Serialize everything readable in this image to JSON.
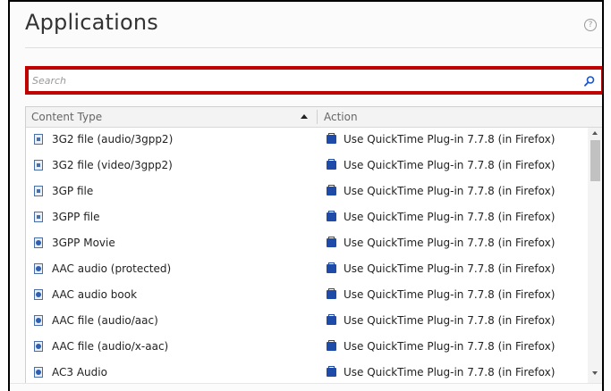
{
  "header": {
    "title": "Applications",
    "help_glyph": "?"
  },
  "search": {
    "placeholder": "Search",
    "value": ""
  },
  "table": {
    "columns": {
      "content_type": "Content Type",
      "action": "Action"
    },
    "sort_column": "content_type",
    "sort_direction": "ascending",
    "rows": [
      {
        "type": "3G2 file (audio/3gpp2)",
        "action": "Use QuickTime Plug-in 7.7.8 (in Firefox)",
        "icon": "document-icon"
      },
      {
        "type": "3G2 file (video/3gpp2)",
        "action": "Use QuickTime Plug-in 7.7.8 (in Firefox)",
        "icon": "document-icon"
      },
      {
        "type": "3GP file",
        "action": "Use QuickTime Plug-in 7.7.8 (in Firefox)",
        "icon": "document-icon"
      },
      {
        "type": "3GPP file",
        "action": "Use QuickTime Plug-in 7.7.8 (in Firefox)",
        "icon": "document-icon"
      },
      {
        "type": "3GPP Movie",
        "action": "Use QuickTime Plug-in 7.7.8 (in Firefox)",
        "icon": "media-file-icon"
      },
      {
        "type": "AAC audio (protected)",
        "action": "Use QuickTime Plug-in 7.7.8 (in Firefox)",
        "icon": "media-file-icon"
      },
      {
        "type": "AAC audio book",
        "action": "Use QuickTime Plug-in 7.7.8 (in Firefox)",
        "icon": "media-file-icon"
      },
      {
        "type": "AAC file (audio/aac)",
        "action": "Use QuickTime Plug-in 7.7.8 (in Firefox)",
        "icon": "media-file-icon"
      },
      {
        "type": "AAC file (audio/x-aac)",
        "action": "Use QuickTime Plug-in 7.7.8 (in Firefox)",
        "icon": "media-file-icon"
      },
      {
        "type": "AC3 Audio",
        "action": "Use QuickTime Plug-in 7.7.8 (in Firefox)",
        "icon": "media-file-icon"
      }
    ]
  },
  "colors": {
    "highlight_border": "#c00000",
    "plugin_icon": "#1e4aa8"
  }
}
